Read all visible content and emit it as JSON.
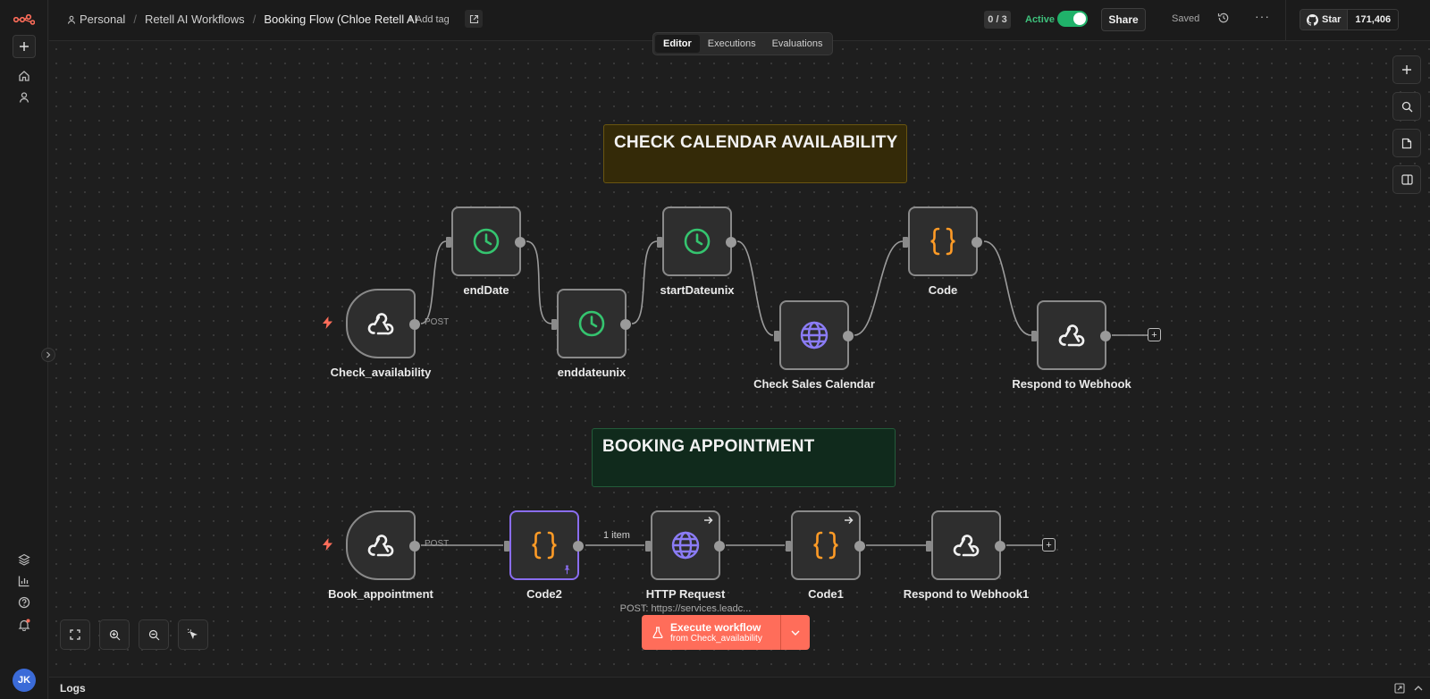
{
  "colors": {
    "accent": "#ff6d5a",
    "active": "#20b26a",
    "clock": "#35c46f",
    "code": "#ff9b26",
    "globe": "#8b7cf6",
    "pinned": "#8a6df0"
  },
  "breadcrumb": {
    "owner": "Personal",
    "project": "Retell AI Workflows",
    "workflow": "Booking Flow (Chloe Retell AI",
    "add_tag": "+ Add tag"
  },
  "header": {
    "counter": "0 / 3",
    "active_label": "Active",
    "share": "Share",
    "saved": "Saved",
    "more": "···",
    "github_star": "Star",
    "github_count": "171,406"
  },
  "tabs": [
    {
      "label": "Editor"
    },
    {
      "label": "Executions"
    },
    {
      "label": "Evaluations"
    }
  ],
  "stickies": [
    {
      "text": "CHECK CALENDAR AVAILABILITY"
    },
    {
      "text": "BOOKING APPOINTMENT"
    }
  ],
  "nodes": {
    "check_availability": {
      "label": "Check_availability",
      "icon": "webhook-icon"
    },
    "enddate": {
      "label": "endDate",
      "icon": "clock-icon"
    },
    "enddateunix": {
      "label": "enddateunix",
      "icon": "clock-icon"
    },
    "startdateunix": {
      "label": "startDateunix",
      "icon": "clock-icon"
    },
    "check_sales_calendar": {
      "label": "Check Sales Calendar",
      "icon": "globe-icon"
    },
    "code": {
      "label": "Code",
      "icon": "code-braces-icon"
    },
    "respond_webhook": {
      "label": "Respond to Webhook",
      "icon": "webhook-icon"
    },
    "book_appointment": {
      "label": "Book_appointment",
      "icon": "webhook-icon"
    },
    "code2": {
      "label": "Code2",
      "icon": "code-braces-icon"
    },
    "http_request": {
      "label": "HTTP Request",
      "subtitle": "POST: https://services.leadc...",
      "icon": "globe-icon"
    },
    "code1": {
      "label": "Code1",
      "icon": "code-braces-icon"
    },
    "respond_webhook1": {
      "label": "Respond to Webhook1",
      "icon": "webhook-icon"
    }
  },
  "edge_labels": {
    "post1": "POST",
    "post2": "POST",
    "items": "1 item"
  },
  "execute": {
    "title": "Execute workflow",
    "subtitle": "from Check_availability"
  },
  "logs": {
    "label": "Logs"
  },
  "avatar": {
    "initials": "JK"
  }
}
